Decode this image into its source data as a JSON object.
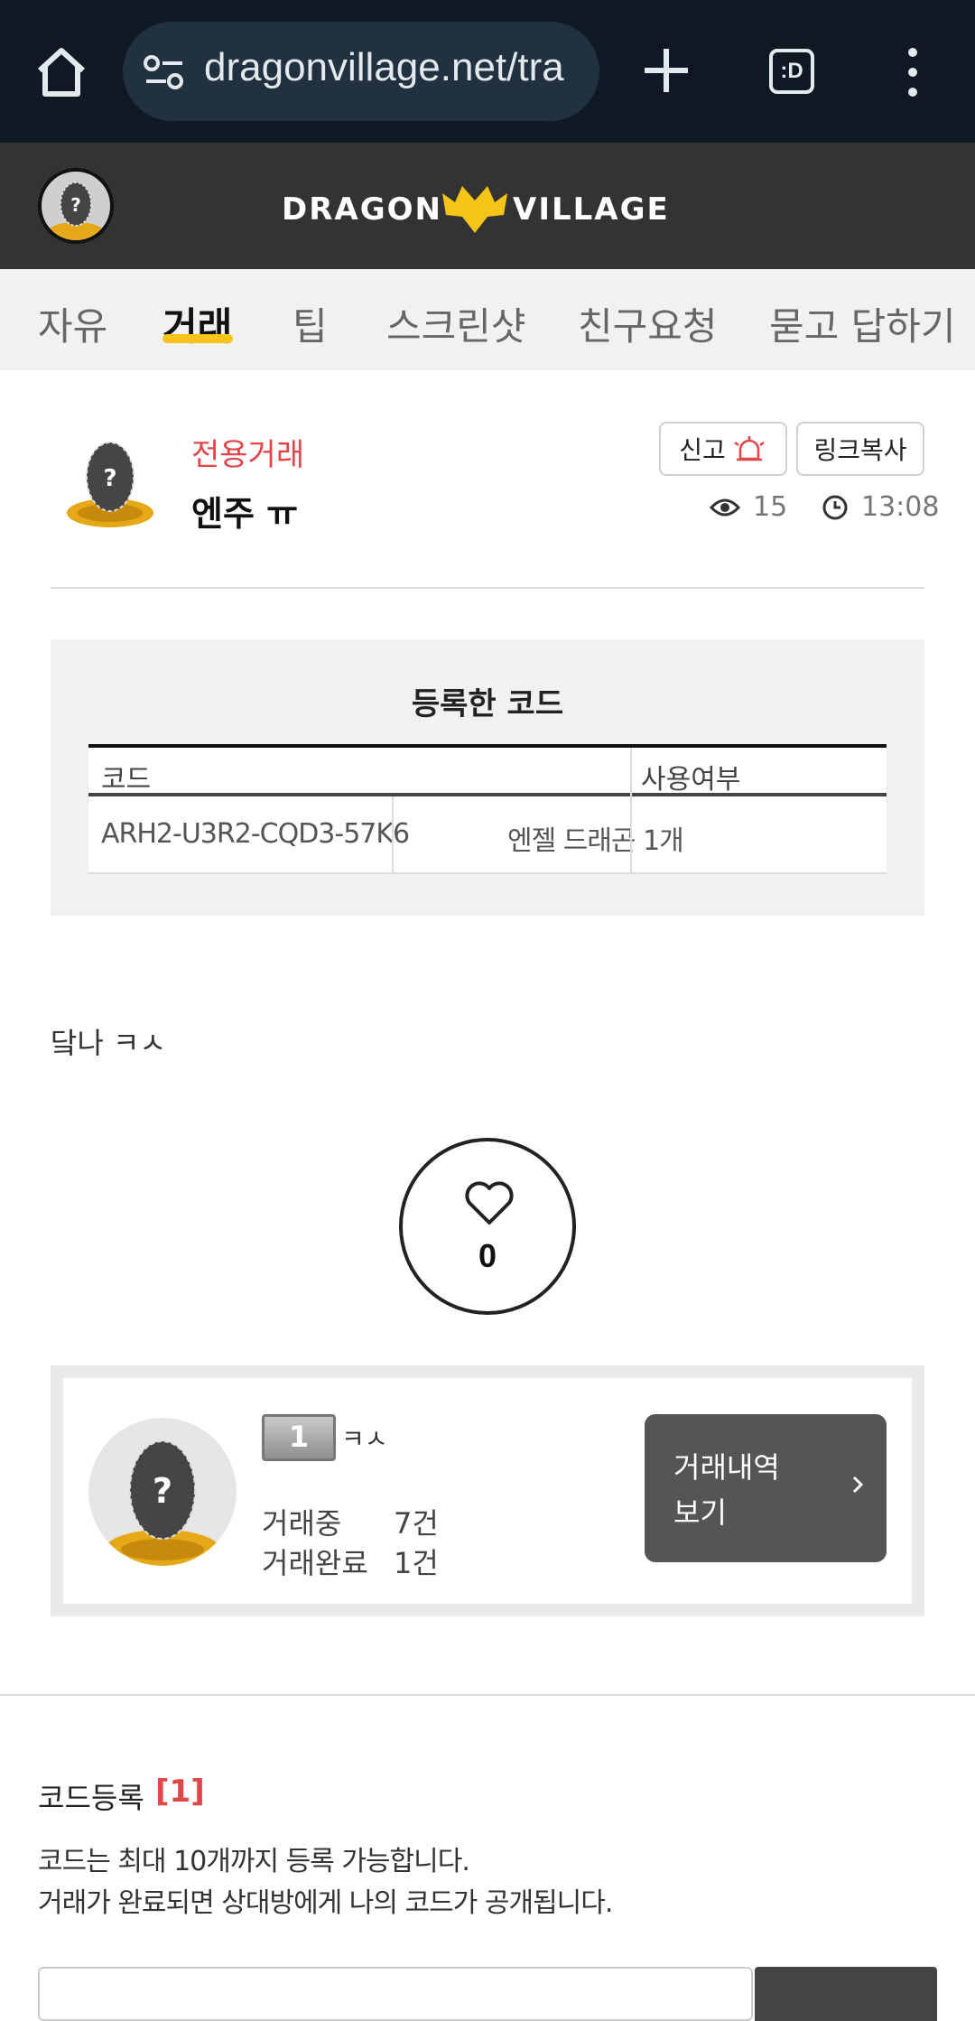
{
  "browser": {
    "url": "dragonvillage.net/tra",
    "tab_label": ":D"
  },
  "site": {
    "logo_left": "DRAGON",
    "logo_right": "VILLAGE",
    "avatar_mark": "?"
  },
  "nav": {
    "tabs": [
      {
        "label": "자유"
      },
      {
        "label": "거래"
      },
      {
        "label": "팁"
      },
      {
        "label": "스크린샷"
      },
      {
        "label": "친구요청"
      },
      {
        "label": "묻고 답하기"
      }
    ],
    "active": "거래"
  },
  "post": {
    "category": "전용거래",
    "author": "엔주 ㅠ",
    "report_label": "신고",
    "copy_link_label": "링크복사",
    "views": "15",
    "time": "13:08",
    "body": "닼나 ㅋㅅ",
    "likes": "0"
  },
  "code_box": {
    "title": "등록한 코드",
    "columns": [
      "코드",
      "사용여부"
    ],
    "rows": [
      {
        "code": "ARH2-U3R2-CQD3-57K6",
        "item": "엔젤 드래곤 1개",
        "used": ""
      }
    ]
  },
  "profile": {
    "level": "1",
    "name": "ㅋㅅ",
    "trading_label": "거래중",
    "trading_value": "7건",
    "done_label": "거래완료",
    "done_value": "1건",
    "history_line1": "거래내역",
    "history_line2": "보기"
  },
  "register": {
    "title": "코드등록",
    "count": "[1]",
    "desc_line1": "코드는 최대 10개까지 등록 가능합니다.",
    "desc_line2": "거래가 완료되면 상대방에게 나의 코드가 공개됩니다."
  },
  "colors": {
    "accent_red": "#e0464a",
    "underline_yellow": "#f7c41a",
    "header_dark": "#333333",
    "browser_dark": "#0f1923"
  }
}
